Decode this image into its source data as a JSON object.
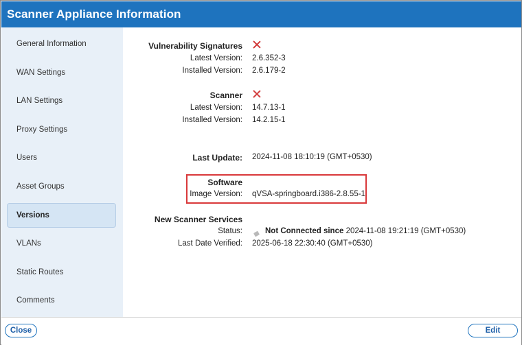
{
  "title": "Scanner Appliance Information",
  "sidebar": {
    "items": [
      {
        "label": "General Information"
      },
      {
        "label": "WAN Settings"
      },
      {
        "label": "LAN Settings"
      },
      {
        "label": "Proxy Settings"
      },
      {
        "label": "Users"
      },
      {
        "label": "Asset Groups"
      },
      {
        "label": "Versions"
      },
      {
        "label": "VLANs"
      },
      {
        "label": "Static Routes"
      },
      {
        "label": "Comments"
      }
    ],
    "active": "Versions"
  },
  "vuln_signatures": {
    "heading": "Vulnerability Signatures",
    "latest_label": "Latest Version:",
    "latest_value": "2.6.352-3",
    "installed_label": "Installed Version:",
    "installed_value": "2.6.179-2",
    "status_icon": "x-icon"
  },
  "scanner": {
    "heading": "Scanner",
    "latest_label": "Latest Version:",
    "latest_value": "14.7.13-1",
    "installed_label": "Installed Version:",
    "installed_value": "14.2.15-1",
    "status_icon": "x-icon"
  },
  "last_update": {
    "label": "Last Update:",
    "value": "2024-11-08 18:10:19 (GMT+0530)"
  },
  "software": {
    "heading": "Software",
    "image_label": "Image Version:",
    "image_value": "qVSA-springboard.i386-2.8.55-1"
  },
  "new_scanner_services": {
    "heading": "New Scanner Services",
    "status_label": "Status:",
    "status_strong": "Not Connected since",
    "status_value": "2024-11-08 19:21:19 (GMT+0530)",
    "verified_label": "Last Date Verified:",
    "verified_value": "2025-06-18 22:30:40 (GMT+0530)"
  },
  "footer": {
    "close_label": "Close",
    "edit_label": "Edit"
  },
  "colors": {
    "titlebar": "#1e73be",
    "sidebar": "#e8f0f8",
    "error_x": "#d23b3b",
    "highlight": "#d9383a"
  }
}
